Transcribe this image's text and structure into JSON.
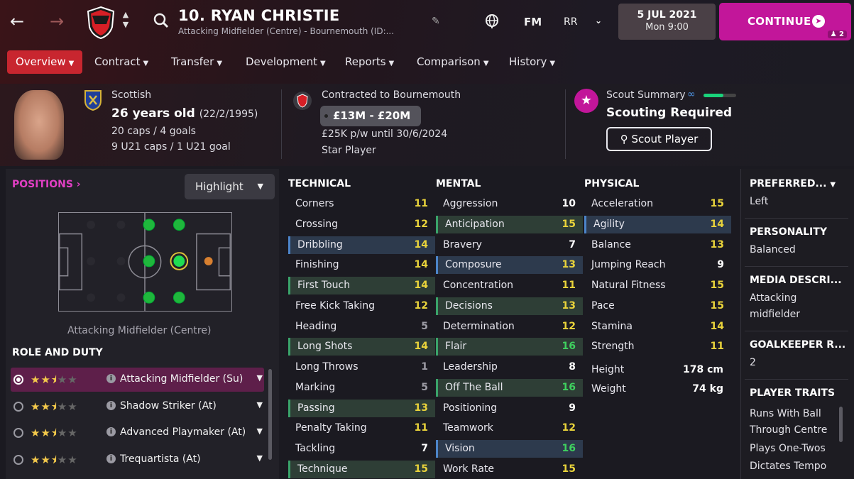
{
  "header": {
    "title": "10. RYAN CHRISTIE",
    "subtitle": "Attacking Midfielder (Centre) - Bournemouth (ID:...",
    "fm_label": "FM",
    "user_initials": "RR",
    "date": "5 JUL 2021",
    "time": "Mon 9:00",
    "continue_label": "CONTINUE",
    "continue_badge": "2"
  },
  "tabs": [
    {
      "label": "Overview",
      "active": true
    },
    {
      "label": "Contract"
    },
    {
      "label": "Transfer"
    },
    {
      "label": "Development"
    },
    {
      "label": "Reports"
    },
    {
      "label": "Comparison"
    },
    {
      "label": "History"
    }
  ],
  "profile": {
    "nationality": "Scottish",
    "age": "26 years old",
    "dob": "(22/2/1995)",
    "caps": "20 caps / 4 goals",
    "u21_caps": "9 U21 caps / 1 U21 goal",
    "contract_heading": "Contracted to Bournemouth",
    "value_range": "£13M - £20M",
    "wage": "£25K p/w until 30/6/2024",
    "status": "Star Player",
    "scout_heading": "Scout Summary",
    "scout_status": "Scouting Required",
    "scout_button": "Scout Player",
    "scout_progress": 0.6
  },
  "positions": {
    "title": "POSITIONS",
    "highlight_label": "Highlight",
    "caption": "Attacking Midfielder (Centre)"
  },
  "role_duty": {
    "title": "ROLE AND DUTY",
    "roles": [
      {
        "name": "Attacking Midfielder (Su)",
        "stars": 2.5,
        "selected": true
      },
      {
        "name": "Shadow Striker (At)",
        "stars": 2.5
      },
      {
        "name": "Advanced Playmaker (At)",
        "stars": 2.5
      },
      {
        "name": "Trequartista (At)",
        "stars": 2.5
      }
    ]
  },
  "attributes": {
    "technical_title": "TECHNICAL",
    "mental_title": "MENTAL",
    "physical_title": "PHYSICAL",
    "technical": [
      {
        "name": "Corners",
        "value": "11"
      },
      {
        "name": "Crossing",
        "value": "12"
      },
      {
        "name": "Dribbling",
        "value": "14"
      },
      {
        "name": "Finishing",
        "value": "14"
      },
      {
        "name": "First Touch",
        "value": "14"
      },
      {
        "name": "Free Kick Taking",
        "value": "12"
      },
      {
        "name": "Heading",
        "value": "5"
      },
      {
        "name": "Long Shots",
        "value": "14"
      },
      {
        "name": "Long Throws",
        "value": "1"
      },
      {
        "name": "Marking",
        "value": "5"
      },
      {
        "name": "Passing",
        "value": "13"
      },
      {
        "name": "Penalty Taking",
        "value": "11"
      },
      {
        "name": "Tackling",
        "value": "7"
      },
      {
        "name": "Technique",
        "value": "15"
      }
    ],
    "mental": [
      {
        "name": "Aggression",
        "value": "10"
      },
      {
        "name": "Anticipation",
        "value": "15"
      },
      {
        "name": "Bravery",
        "value": "7"
      },
      {
        "name": "Composure",
        "value": "13"
      },
      {
        "name": "Concentration",
        "value": "11"
      },
      {
        "name": "Decisions",
        "value": "13"
      },
      {
        "name": "Determination",
        "value": "12"
      },
      {
        "name": "Flair",
        "value": "16"
      },
      {
        "name": "Leadership",
        "value": "8"
      },
      {
        "name": "Off The Ball",
        "value": "16"
      },
      {
        "name": "Positioning",
        "value": "9"
      },
      {
        "name": "Teamwork",
        "value": "12"
      },
      {
        "name": "Vision",
        "value": "16"
      },
      {
        "name": "Work Rate",
        "value": "15"
      }
    ],
    "physical": [
      {
        "name": "Acceleration",
        "value": "15"
      },
      {
        "name": "Agility",
        "value": "14"
      },
      {
        "name": "Balance",
        "value": "13"
      },
      {
        "name": "Jumping Reach",
        "value": "9"
      },
      {
        "name": "Natural Fitness",
        "value": "15"
      },
      {
        "name": "Pace",
        "value": "15"
      },
      {
        "name": "Stamina",
        "value": "14"
      },
      {
        "name": "Strength",
        "value": "11"
      }
    ],
    "height_label": "Height",
    "height_value": "178 cm",
    "weight_label": "Weight",
    "weight_value": "74 kg"
  },
  "side_info": {
    "preferred_foot_title": "PREFERRED...",
    "preferred_foot": "Left",
    "personality_title": "PERSONALITY",
    "personality": "Balanced",
    "media_title": "MEDIA DESCRI...",
    "media_1": "Attacking",
    "media_2": "midfielder",
    "gk_title": "GOALKEEPER R...",
    "gk_value": "2",
    "traits_title": "PLAYER TRAITS",
    "traits": [
      "Runs With Ball",
      "Through Centre",
      "Plays One-Twos",
      "Dictates Tempo"
    ]
  },
  "colors": {
    "accent": "#c2169a",
    "active_tab": "#c8262f",
    "attr_white": "#ffffff",
    "attr_yellow": "#e9d33b",
    "attr_green": "#3fd15f",
    "attr_grey": "#9d9ca5"
  }
}
